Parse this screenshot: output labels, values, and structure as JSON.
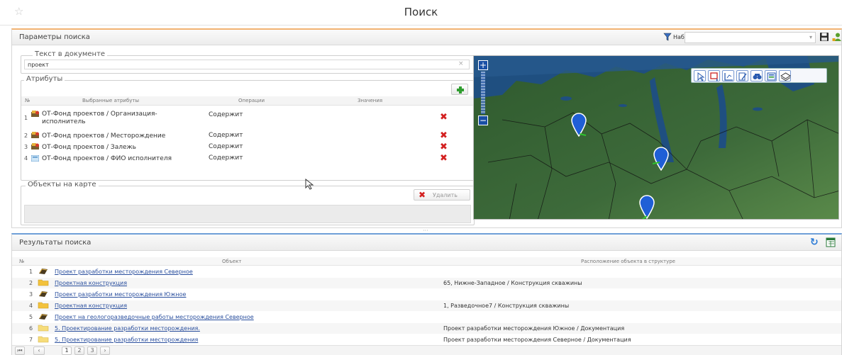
{
  "window": {
    "title": "Поиск"
  },
  "params": {
    "title": "Параметры поиска",
    "search_sets_label": "Наборы поиска",
    "search_sets_value": "",
    "text_legend": "Текст в документе",
    "text_value": "проект",
    "attr_legend": "Атрибуты",
    "attr_columns": {
      "num": "№",
      "selected": "Выбранные атрибуты",
      "operation": "Операции",
      "values": "Значения"
    },
    "attributes": [
      {
        "num": "1",
        "label": "ОТ-Фонд проектов / Организация-исполнитель",
        "op": "Содержит",
        "icon": "ot-db-icon"
      },
      {
        "num": "2",
        "label": "ОТ-Фонд проектов / Месторождение",
        "op": "Содержит",
        "icon": "ot-db-icon"
      },
      {
        "num": "3",
        "label": "ОТ-Фонд проектов / Залежь",
        "op": "Содержит",
        "icon": "ot-db-icon"
      },
      {
        "num": "4",
        "label": "ОТ-Фонд проектов / ФИО исполнителя",
        "op": "Содержит",
        "icon": "ot-card-icon"
      }
    ],
    "map_objects_legend": "Объекты на карте",
    "delete_label": "Удалить"
  },
  "results": {
    "title": "Результаты поиска",
    "columns": {
      "num": "№",
      "object": "Объект",
      "location": "Расположение объекта в структуре"
    },
    "rows": [
      {
        "num": "1",
        "icon": "project-icon",
        "object": "Проект разработки месторождения Северное",
        "location": ""
      },
      {
        "num": "2",
        "icon": "folder-icon",
        "object": "Проектная конструкция",
        "location": "65, Нижне-Западное / Конструкция скважины"
      },
      {
        "num": "3",
        "icon": "project-icon",
        "object": "Проект разработки месторождения Южное",
        "location": ""
      },
      {
        "num": "4",
        "icon": "folder-icon",
        "object": "Проектная конструкция",
        "location": "1, Разведочное7 / Конструкция скважины"
      },
      {
        "num": "5",
        "icon": "project-icon",
        "object": "Проект на геологоразведочные работы месторождения Северное",
        "location": ""
      },
      {
        "num": "6",
        "icon": "folder-icon",
        "object": "5. Проектирование разработки месторождения.",
        "location": "Проект разработки месторождения Южное / Документация"
      },
      {
        "num": "7",
        "icon": "folder-icon",
        "object": "5. Проектирование разработки месторождения",
        "location": "Проект разработки месторождения Северное / Документация"
      }
    ],
    "pages": [
      "1",
      "2",
      "3"
    ],
    "current_page": "1"
  },
  "colors": {
    "params_accent": "#f2b272",
    "results_accent": "#6f9fd8",
    "link": "#2a4f9e",
    "delete": "#d32020",
    "marker": "#1f5fd6"
  }
}
